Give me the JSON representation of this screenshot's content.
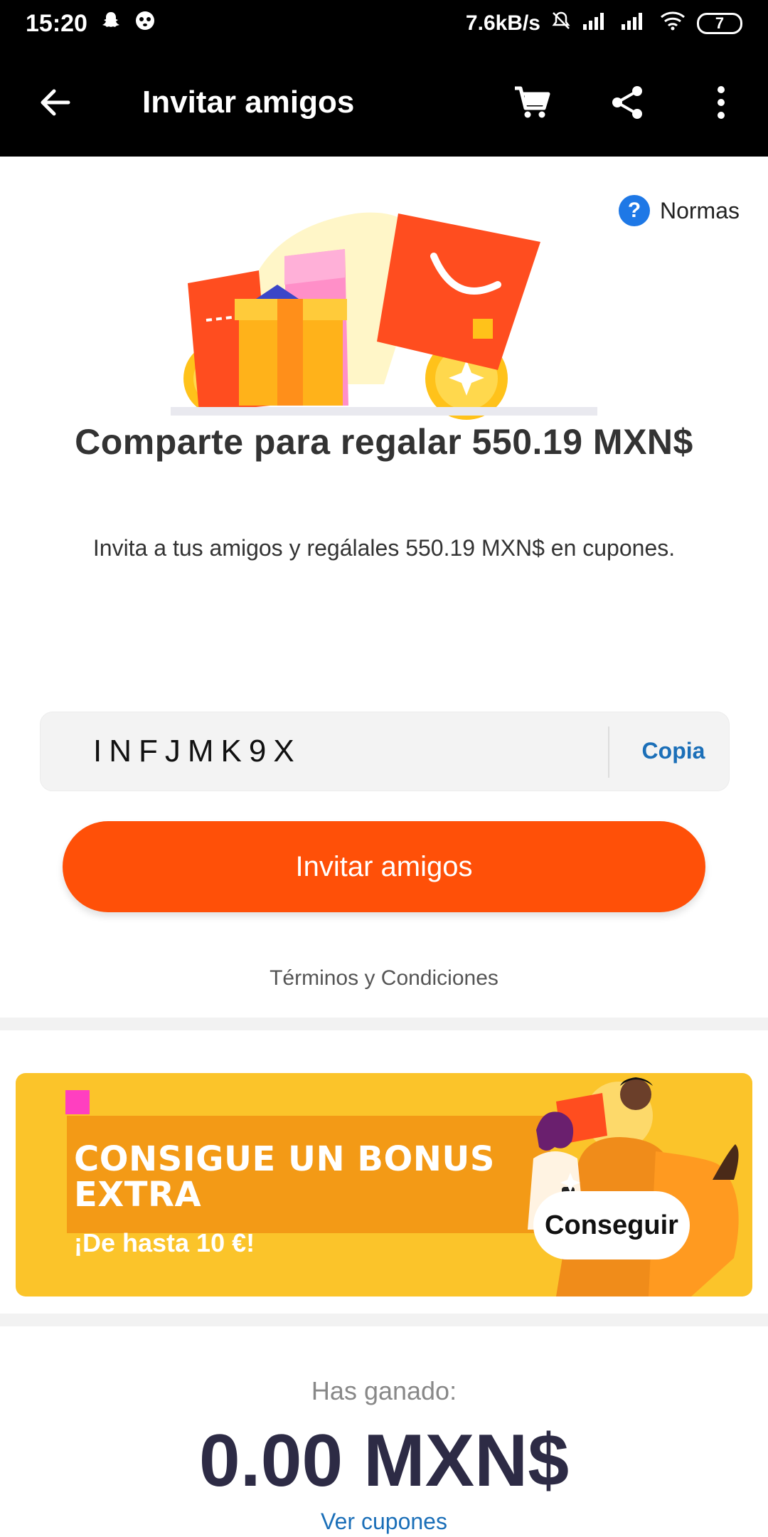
{
  "status_bar": {
    "time": "15:20",
    "network_speed": "7.6kB/s",
    "battery_level": "7",
    "icons": [
      "snapchat-icon",
      "pandora-icon",
      "mute-icon",
      "signal-icon",
      "signal-icon",
      "wifi-icon",
      "battery-icon"
    ]
  },
  "app_bar": {
    "title": "Invitar amigos",
    "icons": [
      "back-arrow-icon",
      "cart-icon",
      "share-icon",
      "more-vertical-icon"
    ]
  },
  "rules_link": {
    "label": "Normas",
    "icon_text": "?"
  },
  "hero": {
    "headline": "Comparte para regalar 550.19 MXN$",
    "subline": "Invita a tus amigos y regálales 550.19 MXN$ en cupones."
  },
  "invite_code": {
    "value": "INFJMK9X",
    "copy_label": "Copia"
  },
  "invite_button": {
    "label": "Invitar amigos"
  },
  "terms": {
    "label": "Términos y Condiciones"
  },
  "bonus_banner": {
    "title": "CONSIGUE UN BONUS EXTRA",
    "subtitle": "¡De hasta 10 €!",
    "button_label": "Conseguir"
  },
  "earnings": {
    "label": "Has ganado:",
    "amount": "0.00 MXN$",
    "link": "Ver cupones"
  },
  "colors": {
    "primary_orange": "#ff5008",
    "banner_yellow": "#fbc42a",
    "link_blue": "#1b6fb8",
    "amount_navy": "#2d2b45"
  }
}
